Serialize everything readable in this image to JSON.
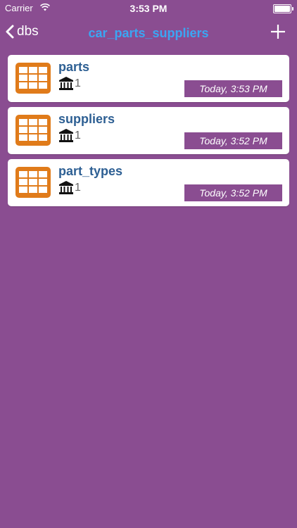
{
  "status_bar": {
    "carrier": "Carrier",
    "time": "3:53 PM"
  },
  "nav": {
    "back_label": "dbs",
    "title": "car_parts_suppliers"
  },
  "tables": [
    {
      "name": "parts",
      "count": "1",
      "timestamp": "Today, 3:53 PM"
    },
    {
      "name": "suppliers",
      "count": "1",
      "timestamp": "Today, 3:52 PM"
    },
    {
      "name": "part_types",
      "count": "1",
      "timestamp": "Today, 3:52 PM"
    }
  ],
  "colors": {
    "background": "#8a4d91",
    "title": "#3ba6f3",
    "row_title": "#2d5f93",
    "table_icon": "#e07b1a",
    "badge_bg": "#8a4d91"
  },
  "icons": {
    "back": "chevron-left-icon",
    "add": "plus-icon",
    "table": "table-grid-icon",
    "count": "bank-columns-icon"
  }
}
